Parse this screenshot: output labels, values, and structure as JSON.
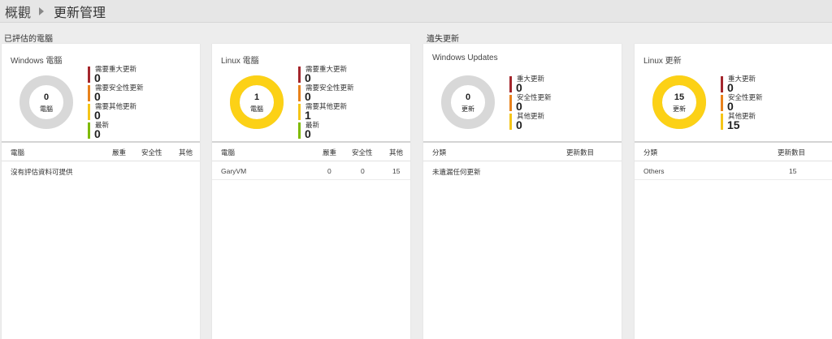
{
  "breadcrumb": {
    "root": "概觀",
    "current": "更新管理"
  },
  "sections": {
    "assessed": "已評估的電腦",
    "missing": "遺失更新"
  },
  "colors": {
    "critical": "#a4262c",
    "security": "#e8821c",
    "other": "#f5c518",
    "uptodate": "#7fba00",
    "donut_empty": "#d8d8d8",
    "donut_filled": "#fcd116"
  },
  "windows_computers": {
    "title": "Windows 電腦",
    "donut_value": "0",
    "donut_unit": "電腦",
    "donut_fill_fraction": 0,
    "legend": [
      {
        "label": "需要重大更新",
        "value": "0",
        "color": "critical"
      },
      {
        "label": "需要安全性更新",
        "value": "0",
        "color": "security"
      },
      {
        "label": "需要其他更新",
        "value": "0",
        "color": "other"
      },
      {
        "label": "最新",
        "value": "0",
        "color": "uptodate"
      }
    ],
    "columns": [
      "電腦",
      "嚴重",
      "安全性",
      "其他"
    ],
    "empty_message": "沒有評估資料可提供"
  },
  "linux_computers": {
    "title": "Linux 電腦",
    "donut_value": "1",
    "donut_unit": "電腦",
    "donut_fill_fraction": 1,
    "legend": [
      {
        "label": "需要重大更新",
        "value": "0",
        "color": "critical"
      },
      {
        "label": "需要安全性更新",
        "value": "0",
        "color": "security"
      },
      {
        "label": "需要其他更新",
        "value": "1",
        "color": "other"
      },
      {
        "label": "最新",
        "value": "0",
        "color": "uptodate"
      }
    ],
    "columns": [
      "電腦",
      "嚴重",
      "安全性",
      "其他"
    ],
    "rows": [
      {
        "name": "GaryVM",
        "critical": "0",
        "security": "0",
        "other": "15"
      }
    ]
  },
  "windows_updates": {
    "title": "Windows Updates",
    "donut_value": "0",
    "donut_unit": "更新",
    "donut_fill_fraction": 0,
    "legend": [
      {
        "label": "重大更新",
        "value": "0",
        "color": "critical"
      },
      {
        "label": "安全性更新",
        "value": "0",
        "color": "security"
      },
      {
        "label": "其他更新",
        "value": "0",
        "color": "other"
      }
    ],
    "columns": [
      "分類",
      "更新數目"
    ],
    "empty_message": "未遺漏任何更新"
  },
  "linux_updates": {
    "title": "Linux 更新",
    "donut_value": "15",
    "donut_unit": "更新",
    "donut_fill_fraction": 1,
    "legend": [
      {
        "label": "重大更新",
        "value": "0",
        "color": "critical"
      },
      {
        "label": "安全性更新",
        "value": "0",
        "color": "security"
      },
      {
        "label": "其他更新",
        "value": "15",
        "color": "other"
      }
    ],
    "columns": [
      "分類",
      "更新數目"
    ],
    "rows": [
      {
        "category": "Others",
        "count": "15"
      }
    ]
  }
}
